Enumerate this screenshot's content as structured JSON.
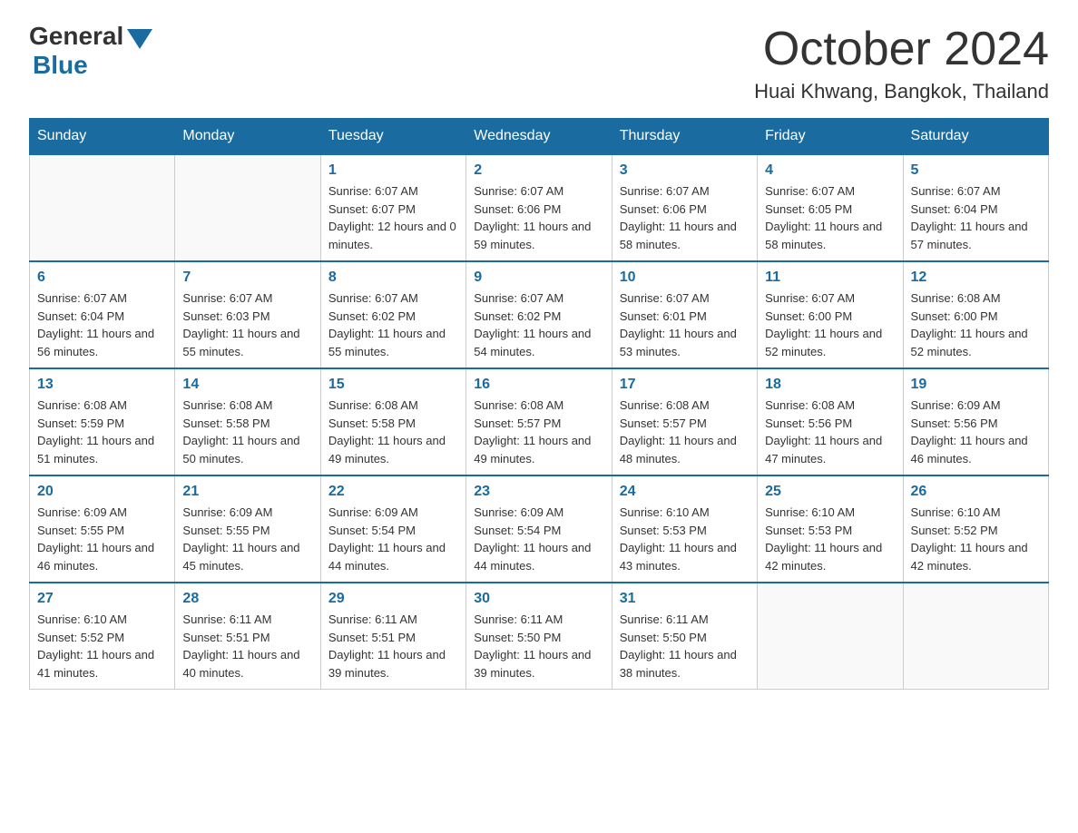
{
  "header": {
    "logo_general": "General",
    "logo_blue": "Blue",
    "title": "October 2024",
    "location": "Huai Khwang, Bangkok, Thailand"
  },
  "days_of_week": [
    "Sunday",
    "Monday",
    "Tuesday",
    "Wednesday",
    "Thursday",
    "Friday",
    "Saturday"
  ],
  "weeks": [
    [
      {
        "day": "",
        "info": ""
      },
      {
        "day": "",
        "info": ""
      },
      {
        "day": "1",
        "info": "Sunrise: 6:07 AM\nSunset: 6:07 PM\nDaylight: 12 hours and 0 minutes."
      },
      {
        "day": "2",
        "info": "Sunrise: 6:07 AM\nSunset: 6:06 PM\nDaylight: 11 hours and 59 minutes."
      },
      {
        "day": "3",
        "info": "Sunrise: 6:07 AM\nSunset: 6:06 PM\nDaylight: 11 hours and 58 minutes."
      },
      {
        "day": "4",
        "info": "Sunrise: 6:07 AM\nSunset: 6:05 PM\nDaylight: 11 hours and 58 minutes."
      },
      {
        "day": "5",
        "info": "Sunrise: 6:07 AM\nSunset: 6:04 PM\nDaylight: 11 hours and 57 minutes."
      }
    ],
    [
      {
        "day": "6",
        "info": "Sunrise: 6:07 AM\nSunset: 6:04 PM\nDaylight: 11 hours and 56 minutes."
      },
      {
        "day": "7",
        "info": "Sunrise: 6:07 AM\nSunset: 6:03 PM\nDaylight: 11 hours and 55 minutes."
      },
      {
        "day": "8",
        "info": "Sunrise: 6:07 AM\nSunset: 6:02 PM\nDaylight: 11 hours and 55 minutes."
      },
      {
        "day": "9",
        "info": "Sunrise: 6:07 AM\nSunset: 6:02 PM\nDaylight: 11 hours and 54 minutes."
      },
      {
        "day": "10",
        "info": "Sunrise: 6:07 AM\nSunset: 6:01 PM\nDaylight: 11 hours and 53 minutes."
      },
      {
        "day": "11",
        "info": "Sunrise: 6:07 AM\nSunset: 6:00 PM\nDaylight: 11 hours and 52 minutes."
      },
      {
        "day": "12",
        "info": "Sunrise: 6:08 AM\nSunset: 6:00 PM\nDaylight: 11 hours and 52 minutes."
      }
    ],
    [
      {
        "day": "13",
        "info": "Sunrise: 6:08 AM\nSunset: 5:59 PM\nDaylight: 11 hours and 51 minutes."
      },
      {
        "day": "14",
        "info": "Sunrise: 6:08 AM\nSunset: 5:58 PM\nDaylight: 11 hours and 50 minutes."
      },
      {
        "day": "15",
        "info": "Sunrise: 6:08 AM\nSunset: 5:58 PM\nDaylight: 11 hours and 49 minutes."
      },
      {
        "day": "16",
        "info": "Sunrise: 6:08 AM\nSunset: 5:57 PM\nDaylight: 11 hours and 49 minutes."
      },
      {
        "day": "17",
        "info": "Sunrise: 6:08 AM\nSunset: 5:57 PM\nDaylight: 11 hours and 48 minutes."
      },
      {
        "day": "18",
        "info": "Sunrise: 6:08 AM\nSunset: 5:56 PM\nDaylight: 11 hours and 47 minutes."
      },
      {
        "day": "19",
        "info": "Sunrise: 6:09 AM\nSunset: 5:56 PM\nDaylight: 11 hours and 46 minutes."
      }
    ],
    [
      {
        "day": "20",
        "info": "Sunrise: 6:09 AM\nSunset: 5:55 PM\nDaylight: 11 hours and 46 minutes."
      },
      {
        "day": "21",
        "info": "Sunrise: 6:09 AM\nSunset: 5:55 PM\nDaylight: 11 hours and 45 minutes."
      },
      {
        "day": "22",
        "info": "Sunrise: 6:09 AM\nSunset: 5:54 PM\nDaylight: 11 hours and 44 minutes."
      },
      {
        "day": "23",
        "info": "Sunrise: 6:09 AM\nSunset: 5:54 PM\nDaylight: 11 hours and 44 minutes."
      },
      {
        "day": "24",
        "info": "Sunrise: 6:10 AM\nSunset: 5:53 PM\nDaylight: 11 hours and 43 minutes."
      },
      {
        "day": "25",
        "info": "Sunrise: 6:10 AM\nSunset: 5:53 PM\nDaylight: 11 hours and 42 minutes."
      },
      {
        "day": "26",
        "info": "Sunrise: 6:10 AM\nSunset: 5:52 PM\nDaylight: 11 hours and 42 minutes."
      }
    ],
    [
      {
        "day": "27",
        "info": "Sunrise: 6:10 AM\nSunset: 5:52 PM\nDaylight: 11 hours and 41 minutes."
      },
      {
        "day": "28",
        "info": "Sunrise: 6:11 AM\nSunset: 5:51 PM\nDaylight: 11 hours and 40 minutes."
      },
      {
        "day": "29",
        "info": "Sunrise: 6:11 AM\nSunset: 5:51 PM\nDaylight: 11 hours and 39 minutes."
      },
      {
        "day": "30",
        "info": "Sunrise: 6:11 AM\nSunset: 5:50 PM\nDaylight: 11 hours and 39 minutes."
      },
      {
        "day": "31",
        "info": "Sunrise: 6:11 AM\nSunset: 5:50 PM\nDaylight: 11 hours and 38 minutes."
      },
      {
        "day": "",
        "info": ""
      },
      {
        "day": "",
        "info": ""
      }
    ]
  ]
}
